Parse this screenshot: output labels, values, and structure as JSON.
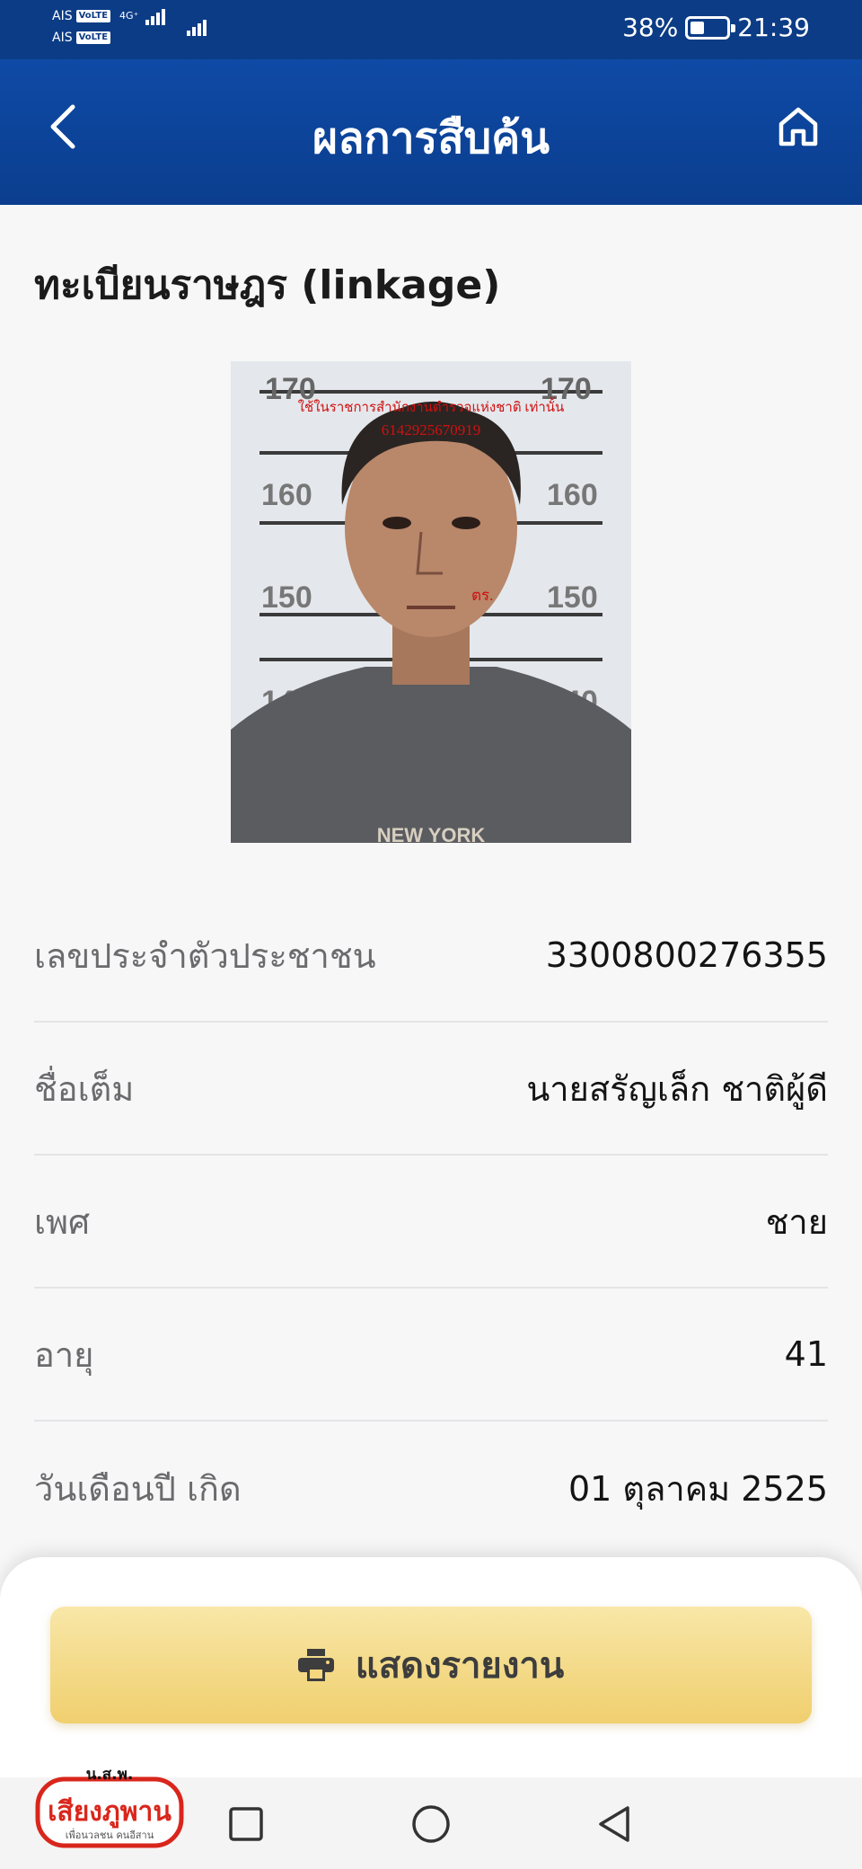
{
  "status_bar": {
    "carrier_1": "AIS",
    "carrier_2": "AIS",
    "volte_1": "VoLTE",
    "volte_2": "VoLTE",
    "network_type": "4G⁺",
    "battery_percent": "38%",
    "battery_level": 0.38,
    "time": "21:39"
  },
  "header": {
    "title": "ผลการสืบค้น",
    "back_icon": "chevron-left-icon",
    "home_icon": "home-icon"
  },
  "section": {
    "title": "ทะเบียนราษฎร (linkage)",
    "photo_text_line1": "ใช้ในราชการสำนักงานตำรวจแห่งชาติ เท่านั้น",
    "photo_text_line2": "6142925670919",
    "photo_text_mark": "ตร.",
    "photo_shirt_text": "NEW YORK",
    "height_chart_labels": [
      "170",
      "170",
      "160",
      "160",
      "150",
      "150",
      "140",
      "140"
    ]
  },
  "info": [
    {
      "label": "เลขประจำตัวประชาชน",
      "value": "3300800276355"
    },
    {
      "label": "ชื่อเต็ม",
      "value": "นายสรัญเล็ก ชาติผู้ดี"
    },
    {
      "label": "เพศ",
      "value": "ชาย"
    },
    {
      "label": "อายุ",
      "value": "41"
    },
    {
      "label": "วันเดือนปี เกิด",
      "value": "01 ตุลาคม 2525"
    }
  ],
  "report_button": {
    "label": "แสดงรายงาน",
    "icon": "printer-icon"
  },
  "watermark": {
    "top_text": "น.ส.พ.",
    "main_text": "เสียงภูพาน",
    "sub_text": "เพื่อนวลชน คนอีสาน"
  },
  "nav": {
    "recent_icon": "square-icon",
    "home_icon": "circle-icon",
    "back_icon": "triangle-back-icon"
  },
  "colors": {
    "header_blue": "#0e4aa6",
    "button_gold": "#f0cf6e",
    "watermark_red": "#d9261c"
  }
}
